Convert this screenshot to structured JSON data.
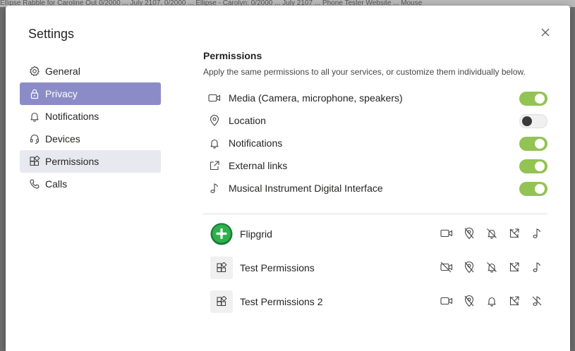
{
  "background_strip": "Ellipse Rabble for Caroline Out 0/2000 ... July 2107, 0/2000 ... Ellipse - Carolyn: 0/2000 ... July 2107 ... Phone Tester Website ... Mouse",
  "dialog": {
    "title": "Settings",
    "close_icon": "close-icon"
  },
  "sidebar": {
    "items": [
      {
        "label": "General",
        "icon": "gear-icon"
      },
      {
        "label": "Privacy",
        "icon": "lock-icon",
        "selected": true
      },
      {
        "label": "Notifications",
        "icon": "bell-icon"
      },
      {
        "label": "Devices",
        "icon": "headset-icon"
      },
      {
        "label": "Permissions",
        "icon": "apps-icon",
        "hovered": true
      },
      {
        "label": "Calls",
        "icon": "phone-icon"
      }
    ]
  },
  "permissions": {
    "title": "Permissions",
    "subtitle": "Apply the same permissions to all your services, or customize them individually below.",
    "items": [
      {
        "label": "Media (Camera, microphone, speakers)",
        "icon": "camera-icon",
        "enabled": true
      },
      {
        "label": "Location",
        "icon": "location-icon",
        "enabled": false
      },
      {
        "label": "Notifications",
        "icon": "bell-icon",
        "enabled": true
      },
      {
        "label": "External links",
        "icon": "external-link-icon",
        "enabled": true
      },
      {
        "label": "Musical Instrument Digital Interface",
        "icon": "music-note-icon",
        "enabled": true
      }
    ]
  },
  "apps": [
    {
      "name": "Flipgrid",
      "icon": "flipgrid-logo",
      "perms": {
        "camera": "allowed",
        "location": "blocked",
        "bell": "blocked",
        "link": "blocked",
        "music": "allowed"
      }
    },
    {
      "name": "Test Permissions",
      "icon": "apps-icon",
      "perms": {
        "camera": "blocked",
        "location": "blocked",
        "bell": "blocked",
        "link": "blocked",
        "music": "allowed"
      }
    },
    {
      "name": "Test Permissions 2",
      "icon": "apps-icon",
      "perms": {
        "camera": "allowed",
        "location": "blocked",
        "bell": "allowed",
        "link": "blocked",
        "music": "blocked"
      }
    }
  ],
  "colors": {
    "accent": "#8b8cc7",
    "toggle_on": "#92c353",
    "flipgrid_green": "#2bb34a"
  }
}
